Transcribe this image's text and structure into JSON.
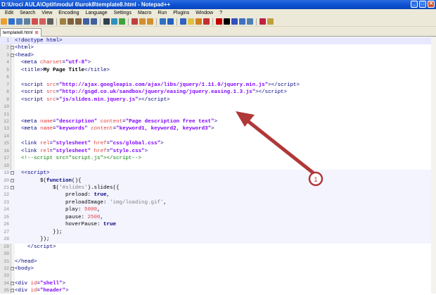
{
  "window": {
    "title": "D:\\Uroci AULA\\Optit\\modul 6\\urok8\\template8.html - Notepad++",
    "min": "_",
    "max": "□",
    "close": "✕"
  },
  "menu": [
    "Edit",
    "Search",
    "View",
    "Encoding",
    "Language",
    "Settings",
    "Macro",
    "Run",
    "Plugins",
    "Window",
    "?"
  ],
  "toolbar_colors": [
    "#e8a030",
    "#3070d0",
    "#5080c0",
    "#6080a0",
    "#d05050",
    "#d06060",
    "#606060",
    "#a08040",
    "#806040",
    "#806040",
    "#4060a0",
    "#4060a0",
    "#304050",
    "#3090c0",
    "#40a040",
    "#c04040",
    "#d09030",
    "#d09030",
    "#3070c0",
    "#2060c0",
    "#3060c0",
    "#e0c040",
    "#d08020",
    "#c03030",
    "#c00000",
    "#000000",
    "#3050c0",
    "#4070c0",
    "#5080b0",
    "#c02040",
    "#c0a040"
  ],
  "tab": {
    "label": "template8.html",
    "close": "⊠"
  },
  "annotation": {
    "label": "1",
    "color": "#b03838"
  },
  "lines": [
    {
      "n": "1",
      "cls": "cur",
      "fold": "",
      "t": [
        [
          "tag",
          "<!doctype html>"
        ]
      ]
    },
    {
      "n": "2",
      "fold": "−",
      "t": [
        [
          "tag",
          "<html>"
        ]
      ]
    },
    {
      "n": "3",
      "fold": "−",
      "t": [
        [
          "tag",
          "<head>"
        ]
      ]
    },
    {
      "n": "4",
      "t": [
        [
          "txt",
          "  "
        ],
        [
          "tag",
          "<meta "
        ],
        [
          "attr",
          "charset"
        ],
        [
          "tag",
          "="
        ],
        [
          "str",
          "\"utf-8\""
        ],
        [
          "tag",
          ">"
        ]
      ]
    },
    {
      "n": "5",
      "t": [
        [
          "txt",
          "  "
        ],
        [
          "tag",
          "<title>"
        ],
        [
          "bold",
          "My Page Title"
        ],
        [
          "tag",
          "</title>"
        ]
      ]
    },
    {
      "n": "6",
      "t": []
    },
    {
      "n": "7",
      "t": [
        [
          "txt",
          "  "
        ],
        [
          "tag",
          "<script "
        ],
        [
          "attr",
          "src"
        ],
        [
          "tag",
          "="
        ],
        [
          "str",
          "\"http://ajax.googleapis.com/ajax/libs/jquery/1.11.0/jquery.min.js\""
        ],
        [
          "tag",
          "></script>"
        ]
      ]
    },
    {
      "n": "8",
      "t": [
        [
          "txt",
          "  "
        ],
        [
          "tag",
          "<script "
        ],
        [
          "attr",
          "src"
        ],
        [
          "tag",
          "="
        ],
        [
          "str",
          "\"http://gsgd.co.uk/sandbox/jquery/easing/jquery.easing.1.3.js\""
        ],
        [
          "tag",
          "></script>"
        ]
      ]
    },
    {
      "n": "9",
      "t": [
        [
          "txt",
          "  "
        ],
        [
          "tag",
          "<script "
        ],
        [
          "attr",
          "src"
        ],
        [
          "tag",
          "="
        ],
        [
          "str",
          "\"js/slides.min.jquery.js\""
        ],
        [
          "tag",
          "></script>"
        ]
      ]
    },
    {
      "n": "10",
      "t": []
    },
    {
      "n": "11",
      "t": []
    },
    {
      "n": "12",
      "t": [
        [
          "txt",
          "  "
        ],
        [
          "tag",
          "<meta "
        ],
        [
          "attr",
          "name"
        ],
        [
          "tag",
          "="
        ],
        [
          "str",
          "\"description\""
        ],
        [
          "tag",
          " "
        ],
        [
          "attr",
          "content"
        ],
        [
          "tag",
          "="
        ],
        [
          "str",
          "\"Page description free text\""
        ],
        [
          "tag",
          ">"
        ]
      ]
    },
    {
      "n": "13",
      "t": [
        [
          "txt",
          "  "
        ],
        [
          "tag",
          "<meta "
        ],
        [
          "attr",
          "name"
        ],
        [
          "tag",
          "="
        ],
        [
          "str",
          "\"keywords\""
        ],
        [
          "tag",
          " "
        ],
        [
          "attr",
          "content"
        ],
        [
          "tag",
          "="
        ],
        [
          "str",
          "\"keyword1, keyword2, keyword3\""
        ],
        [
          "tag",
          ">"
        ]
      ]
    },
    {
      "n": "14",
      "t": []
    },
    {
      "n": "15",
      "t": [
        [
          "txt",
          "  "
        ],
        [
          "tag",
          "<link "
        ],
        [
          "attr",
          "rel"
        ],
        [
          "tag",
          "="
        ],
        [
          "str",
          "\"stylesheet\""
        ],
        [
          "tag",
          " "
        ],
        [
          "attr",
          "href"
        ],
        [
          "tag",
          "="
        ],
        [
          "str",
          "\"css/global.css\""
        ],
        [
          "tag",
          ">"
        ]
      ]
    },
    {
      "n": "16",
      "t": [
        [
          "txt",
          "  "
        ],
        [
          "tag",
          "<link "
        ],
        [
          "attr",
          "rel"
        ],
        [
          "tag",
          "="
        ],
        [
          "str",
          "\"stylesheet\""
        ],
        [
          "tag",
          " "
        ],
        [
          "attr",
          "href"
        ],
        [
          "tag",
          "="
        ],
        [
          "str",
          "\"style.css\""
        ],
        [
          "tag",
          ">"
        ]
      ]
    },
    {
      "n": "17",
      "t": [
        [
          "txt",
          "  "
        ],
        [
          "cmt",
          "<!--script src=\"script.js\"></script-->"
        ]
      ]
    },
    {
      "n": "18",
      "t": []
    },
    {
      "n": "19",
      "cls": "blk",
      "fold": "−",
      "t": [
        [
          "txt",
          "  "
        ],
        [
          "tag",
          "<<script>"
        ]
      ]
    },
    {
      "n": "20",
      "cls": "blk",
      "fold": "−",
      "t": [
        [
          "txt",
          "        "
        ],
        [
          "txt",
          "$("
        ],
        [
          "kw",
          "function"
        ],
        [
          "txt",
          "(){"
        ]
      ]
    },
    {
      "n": "21",
      "cls": "blk",
      "fold": "−",
      "t": [
        [
          "txt",
          "            "
        ],
        [
          "txt",
          "$("
        ],
        [
          "jstr",
          "'#slides'"
        ],
        [
          "txt",
          ").slides({"
        ]
      ]
    },
    {
      "n": "22",
      "cls": "blk",
      "t": [
        [
          "txt",
          "                preload: "
        ],
        [
          "kw",
          "true"
        ],
        [
          "txt",
          ","
        ]
      ]
    },
    {
      "n": "23",
      "cls": "blk",
      "t": [
        [
          "txt",
          "                preloadImage: "
        ],
        [
          "jstr",
          "'img/loading.gif'"
        ],
        [
          "txt",
          ","
        ]
      ]
    },
    {
      "n": "24",
      "cls": "blk",
      "t": [
        [
          "txt",
          "                play: "
        ],
        [
          "num",
          "5000"
        ],
        [
          "txt",
          ","
        ]
      ]
    },
    {
      "n": "25",
      "cls": "blk",
      "t": [
        [
          "txt",
          "                pause: "
        ],
        [
          "num",
          "2500"
        ],
        [
          "txt",
          ","
        ]
      ]
    },
    {
      "n": "26",
      "cls": "blk",
      "t": [
        [
          "txt",
          "                hoverPause: "
        ],
        [
          "kw",
          "true"
        ]
      ]
    },
    {
      "n": "27",
      "cls": "blk",
      "t": [
        [
          "txt",
          "            "
        ],
        [
          "txt",
          "});"
        ]
      ]
    },
    {
      "n": "28",
      "cls": "blk",
      "t": [
        [
          "txt",
          "        "
        ],
        [
          "txt",
          "});"
        ]
      ]
    },
    {
      "n": "29",
      "t": [
        [
          "txt",
          "    "
        ],
        [
          "tag",
          "</script>"
        ]
      ]
    },
    {
      "n": "30",
      "t": []
    },
    {
      "n": "31",
      "t": [
        [
          "tag",
          "</head>"
        ]
      ]
    },
    {
      "n": "32",
      "fold": "−",
      "t": [
        [
          "tag",
          "<body>"
        ]
      ]
    },
    {
      "n": "33",
      "t": []
    },
    {
      "n": "34",
      "fold": "−",
      "t": [
        [
          "tag",
          "<div "
        ],
        [
          "attr",
          "id"
        ],
        [
          "tag",
          "="
        ],
        [
          "str",
          "\"shell\""
        ],
        [
          "tag",
          ">"
        ]
      ]
    },
    {
      "n": "35",
      "fold": "−",
      "t": [
        [
          "tag",
          "<div "
        ],
        [
          "attr",
          "id"
        ],
        [
          "tag",
          "="
        ],
        [
          "str",
          "\"header\""
        ],
        [
          "tag",
          ">"
        ]
      ]
    }
  ]
}
